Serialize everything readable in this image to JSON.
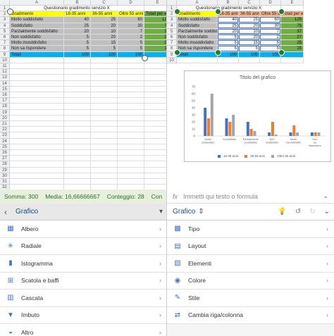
{
  "sheet": {
    "columns": [
      "A",
      "B",
      "C",
      "D",
      "E"
    ],
    "rows": [
      "1",
      "2",
      "3",
      "4",
      "5",
      "6",
      "7",
      "8",
      "9",
      "10",
      "11",
      "12",
      "13",
      "14",
      "15",
      "16",
      "17",
      "18",
      "19",
      "20",
      "21",
      "22",
      "23",
      "24",
      "25",
      "26",
      "27",
      "28",
      "29",
      "30",
      "31",
      "32"
    ],
    "title_cell": "Questionario gradimento servizio X",
    "header": [
      "Gradimento",
      "18-35 anni",
      "36-55 anni",
      "Oltre 55 anni",
      "Totali per età"
    ],
    "data": [
      [
        "Molto soddisfatto",
        "40",
        "25",
        "60",
        "125"
      ],
      [
        "Soddisfatto",
        "25",
        "20",
        "30",
        "75"
      ],
      [
        "Parzialmente soddisfatto",
        "20",
        "10",
        "7",
        "37"
      ],
      [
        "Non soddisfatto",
        "5",
        "20",
        "2",
        "27"
      ],
      [
        "Molto insoddisfatto",
        "5",
        "15",
        "5",
        "25"
      ],
      [
        "Non sa rispondere",
        "5",
        "5",
        "5",
        "15"
      ]
    ],
    "totals": [
      "Totali",
      "100",
      "100",
      "100",
      ""
    ]
  },
  "statusbar": {
    "somma": "Somma: 300",
    "media": "Media: 16,66666667",
    "conteggio": "Conteggio: 28",
    "extra": "Con"
  },
  "formula": {
    "fx": "fx",
    "placeholder": "Immetti qui testo o formula"
  },
  "left_panel": {
    "title": "Grafico",
    "items": [
      {
        "label": "Albero",
        "icon": "treemap-icon"
      },
      {
        "label": "Radiale",
        "icon": "radar-icon"
      },
      {
        "label": "Istogramma",
        "icon": "histogram-icon"
      },
      {
        "label": "Scatola e baffi",
        "icon": "boxplot-icon"
      },
      {
        "label": "Cascata",
        "icon": "waterfall-icon"
      },
      {
        "label": "Imbuto",
        "icon": "funnel-icon"
      },
      {
        "label": "Altro",
        "icon": "other-chart-icon"
      }
    ]
  },
  "right_panel": {
    "title": "Grafico",
    "items": [
      {
        "label": "Tipo",
        "icon": "chart-type-icon"
      },
      {
        "label": "Layout",
        "icon": "layout-icon"
      },
      {
        "label": "Elementi",
        "icon": "elements-icon"
      },
      {
        "label": "Colore",
        "icon": "color-icon"
      },
      {
        "label": "Stile",
        "icon": "style-icon"
      },
      {
        "label": "Cambia riga/colonna",
        "icon": "switch-row-col-icon"
      }
    ]
  },
  "chart_data": {
    "type": "bar",
    "title": "Titolo del grafico",
    "categories": [
      "Molto soddisfatto",
      "Soddisfatto",
      "Parzialmente soddisfatto",
      "Non soddisfatto",
      "Molto insoddisfatto",
      "Non sa rispondere"
    ],
    "series": [
      {
        "name": "18-35 anni",
        "values": [
          40,
          25,
          20,
          5,
          5,
          5
        ],
        "color": "#4472c4"
      },
      {
        "name": "36-55 anni",
        "values": [
          25,
          20,
          10,
          20,
          15,
          5
        ],
        "color": "#ed7d31"
      },
      {
        "name": "Oltre 55 anni",
        "values": [
          60,
          30,
          7,
          2,
          5,
          5
        ],
        "color": "#a5a5a5"
      }
    ],
    "yticks": [
      "0",
      "10",
      "20",
      "30",
      "40",
      "50",
      "60",
      "70"
    ],
    "ylim": [
      0,
      70
    ],
    "legend": "bottom",
    "grid": false
  },
  "colors": {
    "header_yellow": "#ffff00",
    "header_orange": "#f4b183",
    "totals_green": "#70ad47",
    "totals_blue": "#00b0f0",
    "accent": "#1a4d8f"
  }
}
